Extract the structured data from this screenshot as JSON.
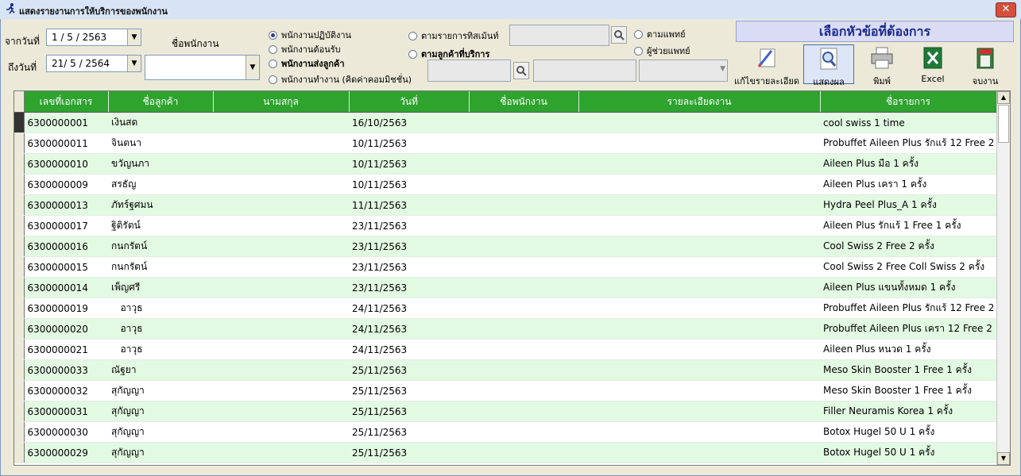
{
  "window": {
    "title": "แสดงรายงานการให้บริการของพนักงาน",
    "close_label": "✕"
  },
  "filters": {
    "from_label": "จากวันที่",
    "from_value": "1 / 5 / 2563",
    "to_label": "ถึงวันที่",
    "to_value": "21/ 5 / 2564",
    "employee_label": "ชื่อพนักงาน",
    "employee_value": ""
  },
  "radios": {
    "r1": "พนักงานปฏิบัติงาน",
    "r2": "พนักงานต้อนรับ",
    "r3": "พนักงานส่งลูกค้า",
    "r4": "พนักงานทำงาน (คิดค่าคอมมิชชั่น)",
    "r5": "ตามรายการทิสเม้นท์",
    "r6": "ตามลูกค้าที่บริการ",
    "r7": "ตามแพทย์",
    "r8": "ผู้ช่วยแพทย์",
    "selected": "r1"
  },
  "toolbar": {
    "header": "เลือกหัวข้อที่ต้องการ",
    "edit": "แก้ไขรายละเอียด",
    "show": "แสดงผล",
    "print": "พิมพ์",
    "excel": "Excel",
    "exit": "จบงาน"
  },
  "table": {
    "columns": [
      "เลขที่เอกสาร",
      "ชื่อลูกค้า",
      "นามสกุล",
      "วันที่",
      "ชื่อพนักงาน",
      "รายละเอียดงาน",
      "ชื่อรายการ"
    ],
    "rows": [
      [
        "6300000001",
        "เงินสด",
        "",
        "16/10/2563",
        "",
        "",
        "cool swiss 1 time"
      ],
      [
        "6300000011",
        "จินตนา",
        "",
        "10/11/2563",
        "",
        "",
        "Probuffet Aileen Plus รักแร้ 12 Free 2"
      ],
      [
        "6300000010",
        "ขวัญนภา",
        "",
        "10/11/2563",
        "",
        "",
        "Aileen Plus มือ 1 ครั้ง"
      ],
      [
        "6300000009",
        "สรธัญ",
        "",
        "10/11/2563",
        "",
        "",
        "Aileen Plus เครา 1 ครั้ง"
      ],
      [
        "6300000013",
        "ภัทร์ฐศมน",
        "",
        "11/11/2563",
        "",
        "",
        "Hydra Peel Plus_A 1 ครั้ง"
      ],
      [
        "6300000017",
        "ฐิติรัตน์",
        "",
        "23/11/2563",
        "",
        "",
        "Aileen Plus รักแร้ 1 Free 1 ครั้ง"
      ],
      [
        "6300000016",
        "กนกรัตน์",
        "",
        "23/11/2563",
        "",
        "",
        "Cool Swiss 2 Free 2 ครั้ง"
      ],
      [
        "6300000015",
        "กนกรัตน์",
        "",
        "23/11/2563",
        "",
        "",
        "Cool Swiss 2 Free Coll Swiss 2 ครั้ง"
      ],
      [
        "6300000014",
        "เพ็ญศรี",
        "",
        "23/11/2563",
        "",
        "",
        "Aileen Plus แขนทั้งหมด 1 ครั้ง"
      ],
      [
        "6300000019",
        "   อาวุธ",
        "",
        "24/11/2563",
        "",
        "",
        "Probuffet Aileen Plus รักแร้ 12 Free 2"
      ],
      [
        "6300000020",
        "   อาวุธ",
        "",
        "24/11/2563",
        "",
        "",
        "Probuffet Aileen Plus เครา 12 Free 2"
      ],
      [
        "6300000021",
        "   อาวุธ",
        "",
        "24/11/2563",
        "",
        "",
        "Aileen Plus หนวด 1 ครั้ง"
      ],
      [
        "6300000033",
        "ณัฐยา",
        "",
        "25/11/2563",
        "",
        "",
        "Meso Skin Booster 1 Free 1 ครั้ง"
      ],
      [
        "6300000032",
        "สุกัญญา",
        "",
        "25/11/2563",
        "",
        "",
        "Meso Skin Booster 1 Free 1 ครั้ง"
      ],
      [
        "6300000031",
        "สุกัญญา",
        "",
        "25/11/2563",
        "",
        "",
        "Filler Neuramis Korea 1 ครั้ง"
      ],
      [
        "6300000030",
        "สุกัญญา",
        "",
        "25/11/2563",
        "",
        "",
        "Botox Hugel 50 U 1 ครั้ง"
      ],
      [
        "6300000029",
        "สุกัญญา",
        "",
        "25/11/2563",
        "",
        "",
        "Botox Hugel 50 U 1 ครั้ง"
      ]
    ]
  }
}
